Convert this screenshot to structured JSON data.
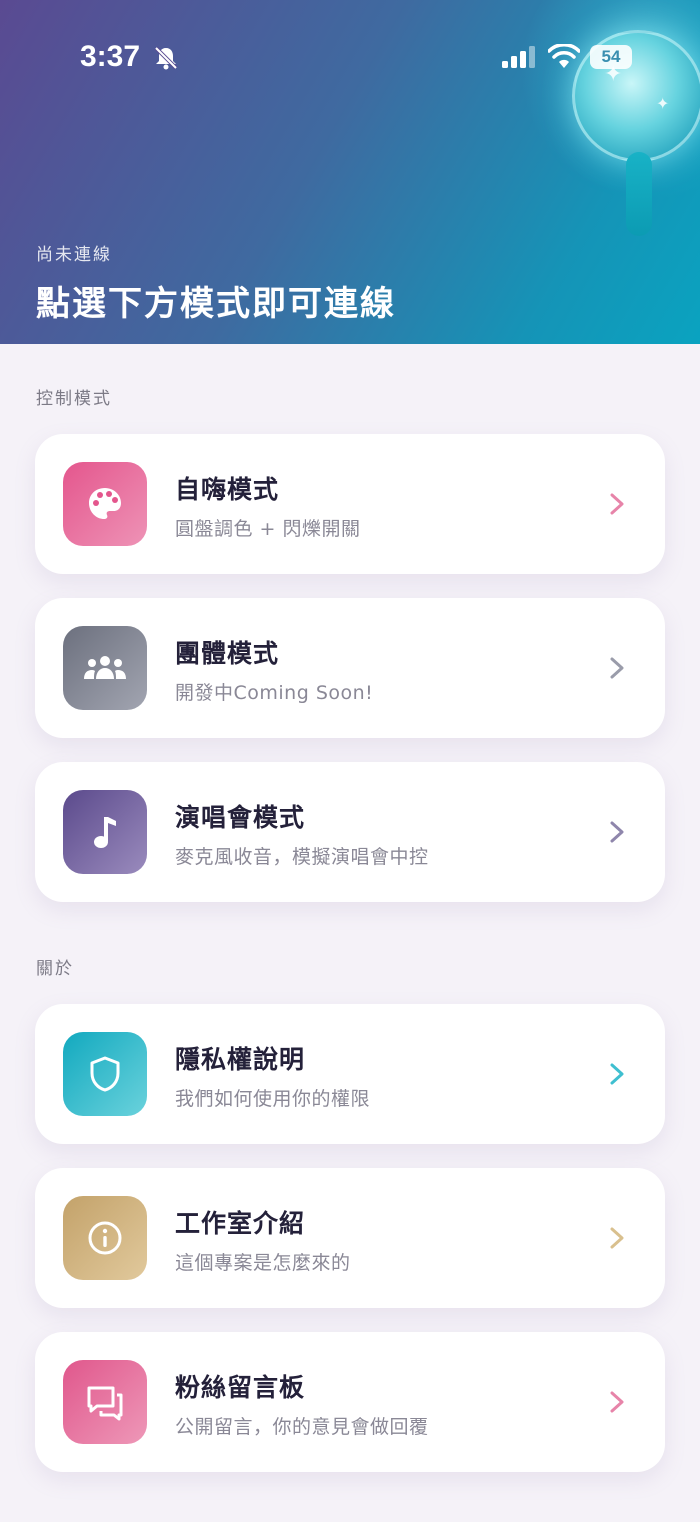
{
  "status_bar": {
    "time": "3:37",
    "battery": "54"
  },
  "header": {
    "status": "尚未連線",
    "title": "點選下方模式即可連線"
  },
  "sections": [
    {
      "label": "控制模式"
    },
    {
      "label": "關於"
    }
  ],
  "cards": [
    {
      "title": "自嗨模式",
      "desc": "圓盤調色 + 閃爍開關",
      "icon": "palette-icon",
      "color": "#e05f95"
    },
    {
      "title": "團體模式",
      "desc": "開發中Coming Soon!",
      "icon": "group-icon",
      "color": "#7b7e8a"
    },
    {
      "title": "演唱會模式",
      "desc": "麥克風收音，模擬演唱會中控",
      "icon": "music-note-icon",
      "color": "#6a5898"
    },
    {
      "title": "隱私權說明",
      "desc": "我們如何使用你的權限",
      "icon": "shield-icon",
      "color": "#1fb3c6"
    },
    {
      "title": "工作室介紹",
      "desc": "這個專案是怎麼來的",
      "icon": "info-icon",
      "color": "#c9a86c"
    },
    {
      "title": "粉絲留言板",
      "desc": "公開留言，你的意見會做回覆",
      "icon": "chat-icon",
      "color": "#e06495"
    }
  ]
}
